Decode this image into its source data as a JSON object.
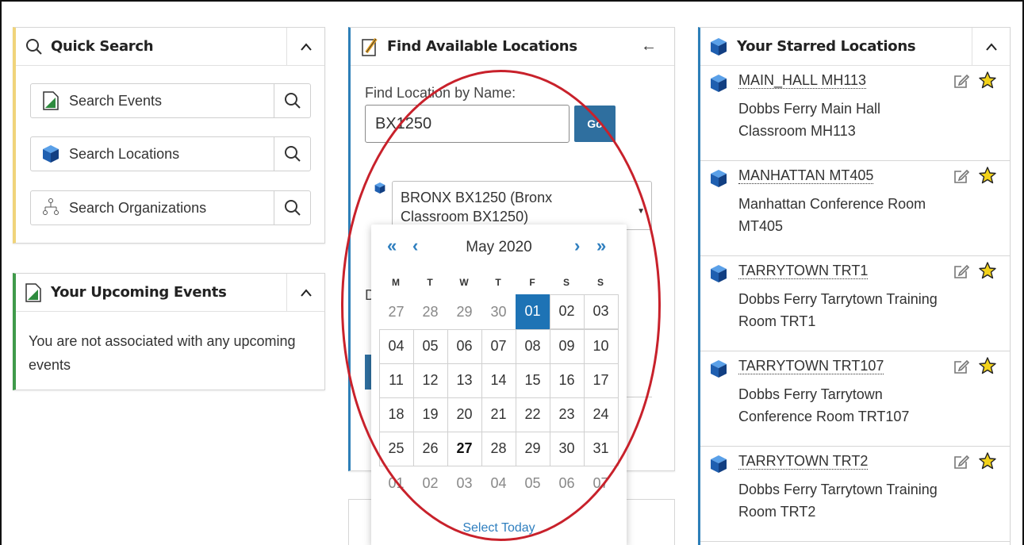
{
  "quick_search": {
    "title": "Quick Search",
    "items": [
      {
        "label": "Search Events",
        "icon": "document-icon"
      },
      {
        "label": "Search Locations",
        "icon": "cube-icon"
      },
      {
        "label": "Search Organizations",
        "icon": "org-chart-icon"
      }
    ]
  },
  "upcoming": {
    "title": "Your Upcoming Events",
    "message": "You are not associated with any upcoming events"
  },
  "find_available": {
    "title": "Find Available Locations",
    "find_label": "Find Location by Name:",
    "name_value": "BX1250",
    "go_label": "Go",
    "selected_location_line1": "BRONX BX1250 (Bronx",
    "selected_location_line2": "Classroom BX1250)",
    "partial_label": "D"
  },
  "calendar": {
    "month": "May 2020",
    "prev_year": "«",
    "prev_month": "‹",
    "next_month": "›",
    "next_year": "»",
    "days_of_week": [
      "M",
      "T",
      "W",
      "T",
      "F",
      "S",
      "S"
    ],
    "weeks": [
      [
        "27",
        "28",
        "29",
        "30",
        "01",
        "02",
        "03"
      ],
      [
        "04",
        "05",
        "06",
        "07",
        "08",
        "09",
        "10"
      ],
      [
        "11",
        "12",
        "13",
        "14",
        "15",
        "16",
        "17"
      ],
      [
        "18",
        "19",
        "20",
        "21",
        "22",
        "23",
        "24"
      ],
      [
        "25",
        "26",
        "27",
        "28",
        "29",
        "30",
        "31"
      ],
      [
        "01",
        "02",
        "03",
        "04",
        "05",
        "06",
        "07"
      ]
    ],
    "selected": "01",
    "today": "27",
    "select_today": "Select Today"
  },
  "starred": {
    "title": "Your Starred Locations",
    "items": [
      {
        "code": "MAIN_HALL MH113",
        "desc": "Dobbs Ferry Main Hall Classroom MH113"
      },
      {
        "code": "MANHATTAN MT405",
        "desc": "Manhattan Conference Room MT405"
      },
      {
        "code": "TARRYTOWN TRT1",
        "desc": "Dobbs Ferry Tarrytown Training Room TRT1"
      },
      {
        "code": "TARRYTOWN TRT107",
        "desc": "Dobbs Ferry Tarrytown Conference Room TRT107"
      },
      {
        "code": "TARRYTOWN TRT2",
        "desc": "Dobbs Ferry Tarrytown Training Room TRT2"
      }
    ]
  },
  "colors": {
    "accent_blue": "#2d7fb8",
    "selected_day": "#1e73b5",
    "highlight_ellipse": "#c8212b",
    "quick_search_border": "#f0d47a",
    "upcoming_border": "#3f9a4a",
    "star": "#f2d21b"
  }
}
